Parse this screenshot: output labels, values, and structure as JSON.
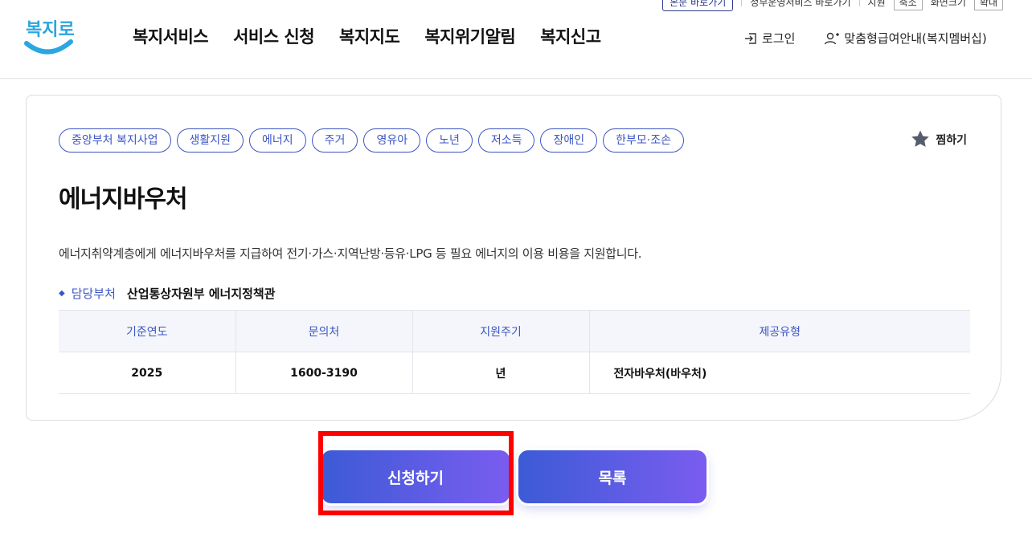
{
  "header": {
    "utility": {
      "item1": "본문 바로가기",
      "item2": "정부운영서비스 바로가기",
      "item3": "지원",
      "item4": "축소",
      "item5": "화면크기",
      "item6": "확대"
    },
    "logo_text": "복지로",
    "nav": [
      "복지서비스",
      "서비스 신청",
      "복지지도",
      "복지위기알림",
      "복지신고"
    ],
    "login_label": "로그인",
    "membership_label": "맞춤형급여안내(복지멤버십)"
  },
  "service": {
    "tags": [
      "중앙부처 복지사업",
      "생활지원",
      "에너지",
      "주거",
      "영유아",
      "노년",
      "저소득",
      "장애인",
      "한부모·조손"
    ],
    "favorite_label": "찜하기",
    "title": "에너지바우처",
    "description": "에너지취약계층에게 에너지바우처를 지급하여 전기·가스·지역난방·등유·LPG 등 필요 에너지의 이용 비용을 지원합니다.",
    "department_label": "담당부처",
    "department_value": "산업통상자원부 에너지정책관",
    "table": {
      "headers": [
        "기준연도",
        "문의처",
        "지원주기",
        "제공유형"
      ],
      "row": [
        "2025",
        "1600-3190",
        "년",
        "전자바우처(바우처)"
      ]
    }
  },
  "buttons": {
    "apply": "신청하기",
    "list": "목록"
  },
  "colors": {
    "accent": "#3c55c4",
    "button_from": "#3c5bd6",
    "button_to": "#7a5cf0",
    "highlight": "#ff0000"
  }
}
